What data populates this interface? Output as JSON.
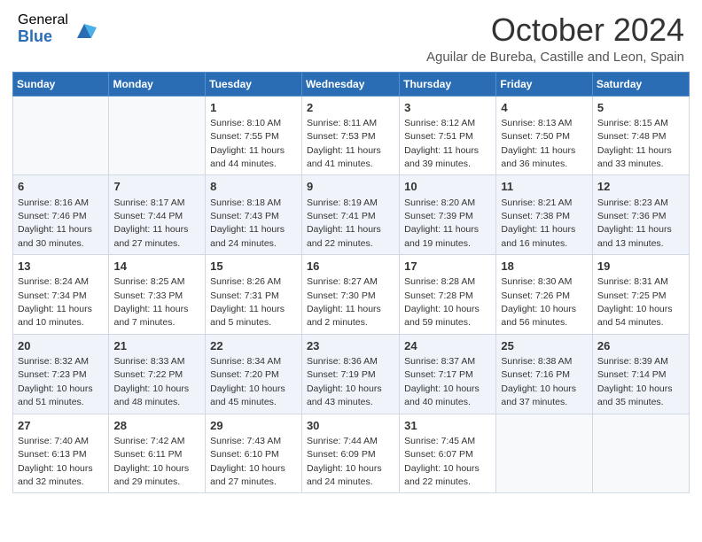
{
  "header": {
    "logo_general": "General",
    "logo_blue": "Blue",
    "title": "October 2024",
    "location": "Aguilar de Bureba, Castille and Leon, Spain"
  },
  "days_of_week": [
    "Sunday",
    "Monday",
    "Tuesday",
    "Wednesday",
    "Thursday",
    "Friday",
    "Saturday"
  ],
  "weeks": [
    [
      {
        "day": "",
        "detail": ""
      },
      {
        "day": "",
        "detail": ""
      },
      {
        "day": "1",
        "detail": "Sunrise: 8:10 AM\nSunset: 7:55 PM\nDaylight: 11 hours and 44 minutes."
      },
      {
        "day": "2",
        "detail": "Sunrise: 8:11 AM\nSunset: 7:53 PM\nDaylight: 11 hours and 41 minutes."
      },
      {
        "day": "3",
        "detail": "Sunrise: 8:12 AM\nSunset: 7:51 PM\nDaylight: 11 hours and 39 minutes."
      },
      {
        "day": "4",
        "detail": "Sunrise: 8:13 AM\nSunset: 7:50 PM\nDaylight: 11 hours and 36 minutes."
      },
      {
        "day": "5",
        "detail": "Sunrise: 8:15 AM\nSunset: 7:48 PM\nDaylight: 11 hours and 33 minutes."
      }
    ],
    [
      {
        "day": "6",
        "detail": "Sunrise: 8:16 AM\nSunset: 7:46 PM\nDaylight: 11 hours and 30 minutes."
      },
      {
        "day": "7",
        "detail": "Sunrise: 8:17 AM\nSunset: 7:44 PM\nDaylight: 11 hours and 27 minutes."
      },
      {
        "day": "8",
        "detail": "Sunrise: 8:18 AM\nSunset: 7:43 PM\nDaylight: 11 hours and 24 minutes."
      },
      {
        "day": "9",
        "detail": "Sunrise: 8:19 AM\nSunset: 7:41 PM\nDaylight: 11 hours and 22 minutes."
      },
      {
        "day": "10",
        "detail": "Sunrise: 8:20 AM\nSunset: 7:39 PM\nDaylight: 11 hours and 19 minutes."
      },
      {
        "day": "11",
        "detail": "Sunrise: 8:21 AM\nSunset: 7:38 PM\nDaylight: 11 hours and 16 minutes."
      },
      {
        "day": "12",
        "detail": "Sunrise: 8:23 AM\nSunset: 7:36 PM\nDaylight: 11 hours and 13 minutes."
      }
    ],
    [
      {
        "day": "13",
        "detail": "Sunrise: 8:24 AM\nSunset: 7:34 PM\nDaylight: 11 hours and 10 minutes."
      },
      {
        "day": "14",
        "detail": "Sunrise: 8:25 AM\nSunset: 7:33 PM\nDaylight: 11 hours and 7 minutes."
      },
      {
        "day": "15",
        "detail": "Sunrise: 8:26 AM\nSunset: 7:31 PM\nDaylight: 11 hours and 5 minutes."
      },
      {
        "day": "16",
        "detail": "Sunrise: 8:27 AM\nSunset: 7:30 PM\nDaylight: 11 hours and 2 minutes."
      },
      {
        "day": "17",
        "detail": "Sunrise: 8:28 AM\nSunset: 7:28 PM\nDaylight: 10 hours and 59 minutes."
      },
      {
        "day": "18",
        "detail": "Sunrise: 8:30 AM\nSunset: 7:26 PM\nDaylight: 10 hours and 56 minutes."
      },
      {
        "day": "19",
        "detail": "Sunrise: 8:31 AM\nSunset: 7:25 PM\nDaylight: 10 hours and 54 minutes."
      }
    ],
    [
      {
        "day": "20",
        "detail": "Sunrise: 8:32 AM\nSunset: 7:23 PM\nDaylight: 10 hours and 51 minutes."
      },
      {
        "day": "21",
        "detail": "Sunrise: 8:33 AM\nSunset: 7:22 PM\nDaylight: 10 hours and 48 minutes."
      },
      {
        "day": "22",
        "detail": "Sunrise: 8:34 AM\nSunset: 7:20 PM\nDaylight: 10 hours and 45 minutes."
      },
      {
        "day": "23",
        "detail": "Sunrise: 8:36 AM\nSunset: 7:19 PM\nDaylight: 10 hours and 43 minutes."
      },
      {
        "day": "24",
        "detail": "Sunrise: 8:37 AM\nSunset: 7:17 PM\nDaylight: 10 hours and 40 minutes."
      },
      {
        "day": "25",
        "detail": "Sunrise: 8:38 AM\nSunset: 7:16 PM\nDaylight: 10 hours and 37 minutes."
      },
      {
        "day": "26",
        "detail": "Sunrise: 8:39 AM\nSunset: 7:14 PM\nDaylight: 10 hours and 35 minutes."
      }
    ],
    [
      {
        "day": "27",
        "detail": "Sunrise: 7:40 AM\nSunset: 6:13 PM\nDaylight: 10 hours and 32 minutes."
      },
      {
        "day": "28",
        "detail": "Sunrise: 7:42 AM\nSunset: 6:11 PM\nDaylight: 10 hours and 29 minutes."
      },
      {
        "day": "29",
        "detail": "Sunrise: 7:43 AM\nSunset: 6:10 PM\nDaylight: 10 hours and 27 minutes."
      },
      {
        "day": "30",
        "detail": "Sunrise: 7:44 AM\nSunset: 6:09 PM\nDaylight: 10 hours and 24 minutes."
      },
      {
        "day": "31",
        "detail": "Sunrise: 7:45 AM\nSunset: 6:07 PM\nDaylight: 10 hours and 22 minutes."
      },
      {
        "day": "",
        "detail": ""
      },
      {
        "day": "",
        "detail": ""
      }
    ]
  ]
}
